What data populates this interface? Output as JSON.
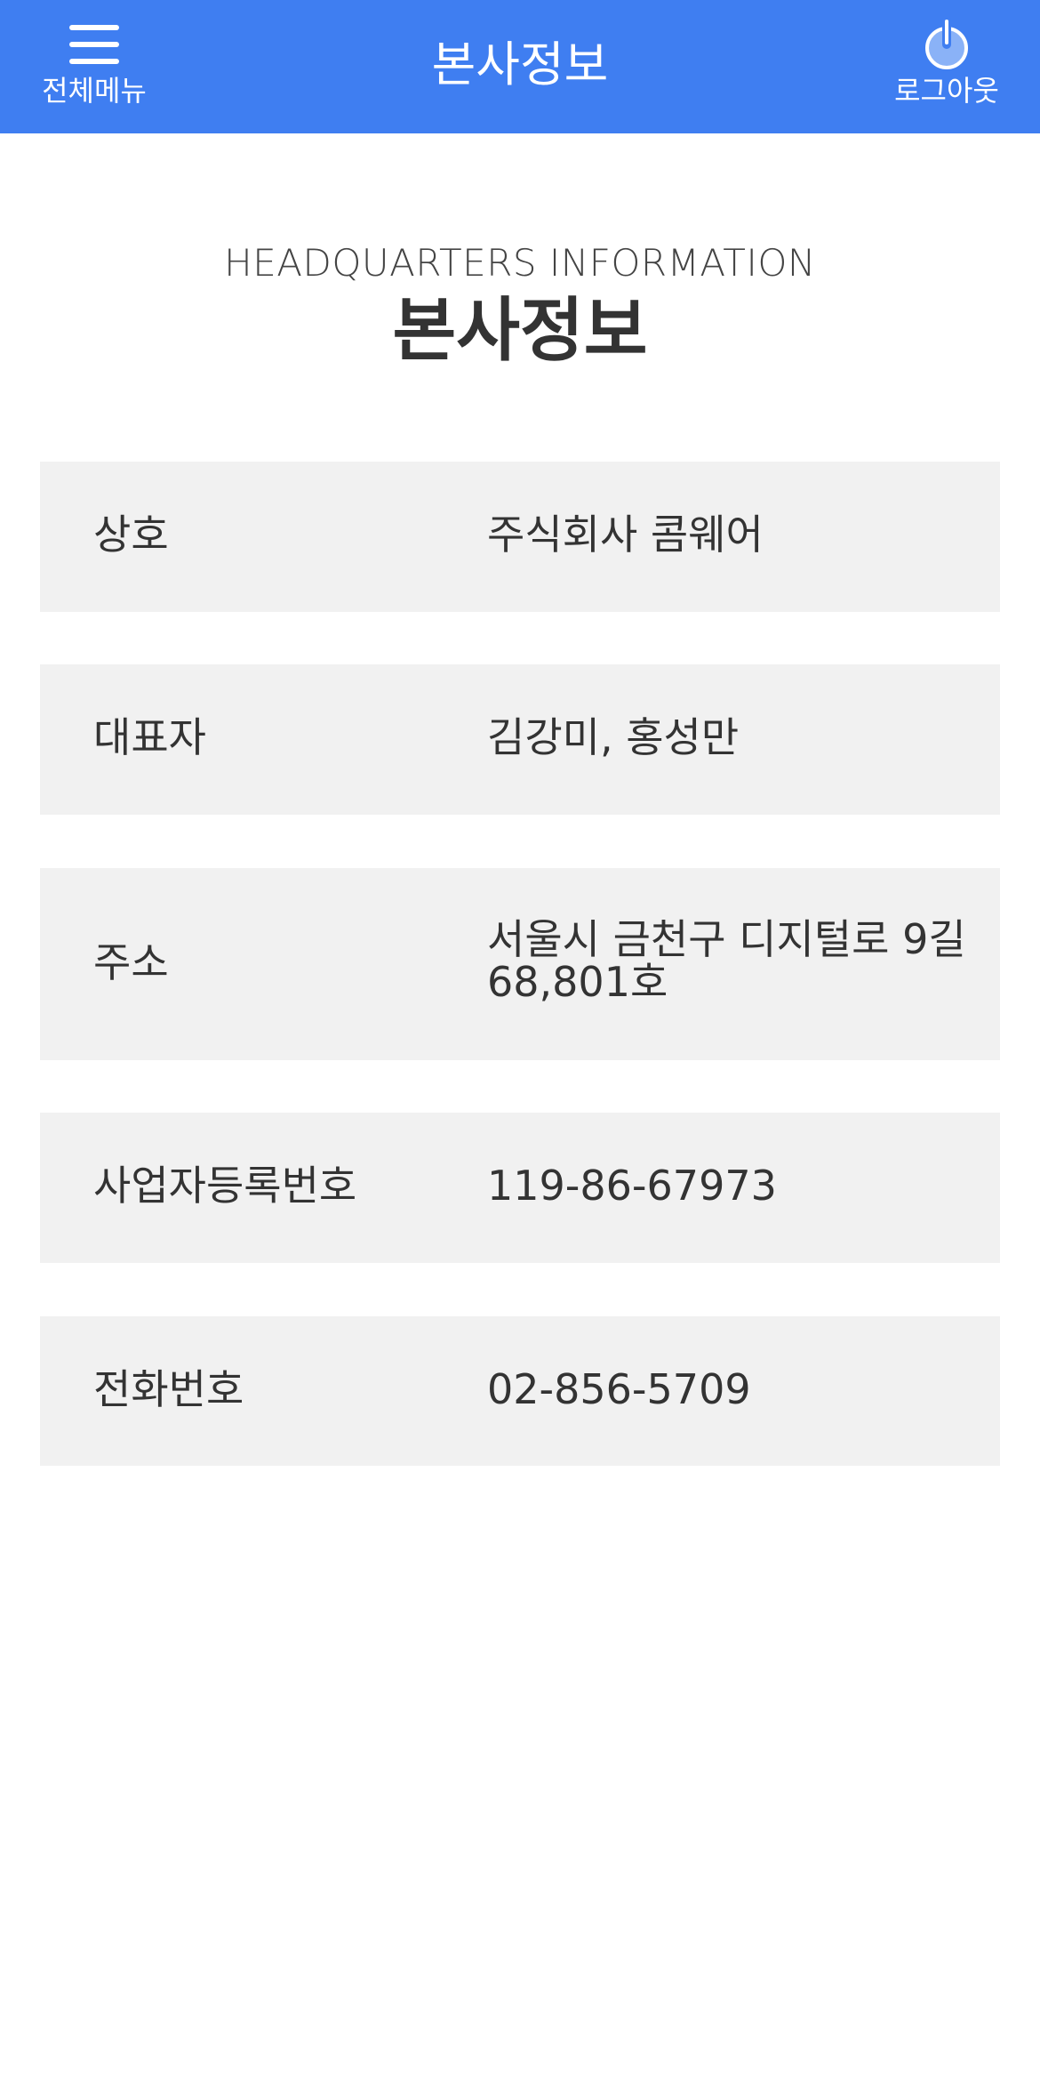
{
  "header": {
    "menu_label": "전체메뉴",
    "title": "본사정보",
    "logout_label": "로그아웃",
    "bg_color": "#3f7ef1"
  },
  "hero": {
    "eng_title": "HEADQUARTERS INFORMATION",
    "title": "본사정보"
  },
  "rows": [
    {
      "label": "상호",
      "value": "주식회사 콤웨어"
    },
    {
      "label": "대표자",
      "value": "김강미, 홍성만"
    },
    {
      "label": "주소",
      "value": "서울시 금천구 디지털로 9길 68,801호"
    },
    {
      "label": "사업자등록번호",
      "value": "119-86-67973"
    },
    {
      "label": "전화번호",
      "value": "02-856-5709"
    }
  ],
  "icons": {
    "menu": "hamburger-menu-icon",
    "logout": "power-icon"
  }
}
